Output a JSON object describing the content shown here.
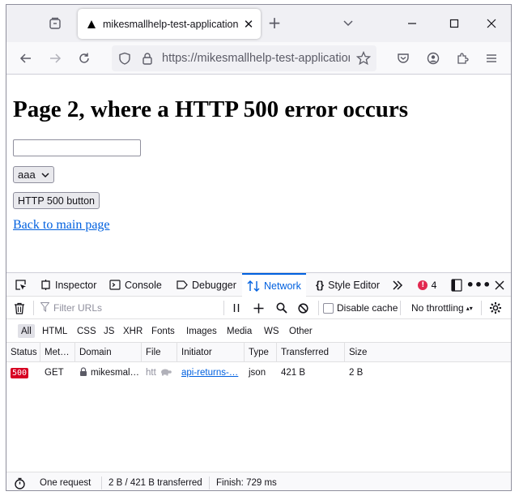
{
  "tab": {
    "title": "mikesmallhelp-test-application"
  },
  "urlbar": {
    "url": "https://mikesmallhelp-test-application"
  },
  "page": {
    "heading": "Page 2, where a HTTP 500 error occurs",
    "input_value": "",
    "select_value": "aaa",
    "button_label": "HTTP 500 button",
    "link_text": "Back to main page"
  },
  "devtools": {
    "tabs": [
      "Inspector",
      "Console",
      "Debugger",
      "Network",
      "Style Editor"
    ],
    "active_tab": "Network",
    "error_count": "4",
    "filter_placeholder": "Filter URLs",
    "disable_cache_label": "Disable cache",
    "throttling": "No throttling",
    "type_filters": [
      "All",
      "HTML",
      "CSS",
      "JS",
      "XHR",
      "Fonts",
      "Images",
      "Media",
      "WS",
      "Other"
    ],
    "active_filter": "All",
    "columns": [
      "Status",
      "Met…",
      "Domain",
      "File",
      "Initiator",
      "Type",
      "Transferred",
      "Size"
    ],
    "rows": [
      {
        "status": "500",
        "method": "GET",
        "domain": "mikesmal…",
        "file": "htt",
        "initiator": "api-returns-…",
        "type": "json",
        "transferred": "421 B",
        "size": "2 B"
      }
    ],
    "statusbar": {
      "requests": "One request",
      "transfer": "2 B / 421 B transferred",
      "finish": "Finish: 729 ms"
    }
  },
  "colors": {
    "accent": "#0060df",
    "error": "#d70022",
    "link": "#0060df"
  }
}
